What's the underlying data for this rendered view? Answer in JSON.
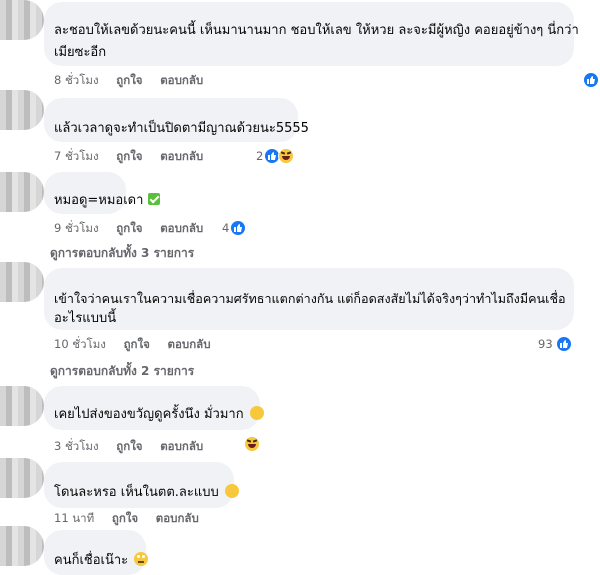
{
  "comments": [
    {
      "text": "ละชอบให้เลขด้วยนะคนนี้ เห็นมานานมาก ชอบให้เลข ให้หวย ละจะมีผู้หญิง คอยอยู่ข้างๆ นี่กว่า",
      "text2": "เมียซะอีก",
      "time": "8 ชั่วโมง",
      "like": "ถูกใจ",
      "reply": "ตอบกลับ",
      "count": ""
    },
    {
      "text": "แล้วเวลาดูจะทำเป็นปิดตามีญาณด้วยนะ5555",
      "time": "7 ชั่วโมง",
      "like": "ถูกใจ",
      "reply": "ตอบกลับ",
      "count": "2"
    },
    {
      "text": "หมอดู=หมอเดา",
      "time": "9 ชั่วโมง",
      "like": "ถูกใจ",
      "reply": "ตอบกลับ",
      "count": "4",
      "replies_link": "ดูการตอบกลับทั้ง 3 รายการ"
    },
    {
      "text": "เข้าใจว่าคนเราในความเชื่อความศรัทธาแตกต่างกัน แต่ก็อดสงสัยไม่ได้จริงๆว่าทำไมถึงมีคนเชื่อ",
      "text2": "อะไรแบบนี้",
      "time": "10 ชั่วโมง",
      "like": "ถูกใจ",
      "reply": "ตอบกลับ",
      "count": "93",
      "replies_link": "ดูการตอบกลับทั้ง 2 รายการ"
    },
    {
      "text": "เคยไปส่งของขวัญดูครั้งนึง มั่วมาก",
      "time": "3 ชั่วโมง",
      "like": "ถูกใจ",
      "reply": "ตอบกลับ",
      "count": ""
    },
    {
      "text": "โดนละหรอ เห็นในตต.ละแบบ",
      "time": "11 นาที",
      "like": "ถูกใจ",
      "reply": "ตอบกลับ",
      "count": ""
    },
    {
      "text": "คนก็เชื่อเน๊าะ",
      "time": "",
      "like": "",
      "reply": "",
      "count": ""
    }
  ],
  "colors": {
    "bubble": "#f0f2f5",
    "meta": "#65676b",
    "like": "#1877f2",
    "haha": "#f7c83c"
  },
  "icons": [
    "like-icon",
    "haha-icon",
    "check-icon",
    "smile-emoji",
    "rolling-eyes-emoji"
  ]
}
